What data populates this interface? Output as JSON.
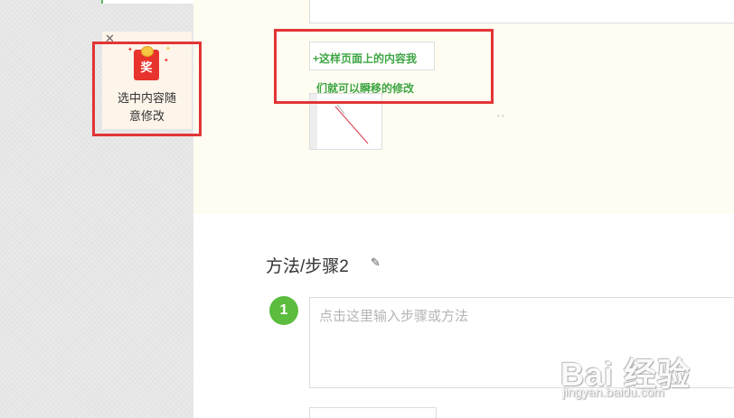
{
  "promo": {
    "close_glyph": "✕",
    "icon_char": "奖",
    "line1": "选中内容随",
    "line2": "意修改",
    "accent_color": "#e8332d"
  },
  "editor": {
    "add_link_label": "+这样页面上的内容我",
    "add_link_label_line2": "们就可以瞬移的修改",
    "accent_color": "#3fa644"
  },
  "section": {
    "title": "方法/步骤2",
    "step_number": "1",
    "step_placeholder": "点击这里输入步骤或方法"
  },
  "watermark": {
    "logo_text": "Bai 经验",
    "url_text": "jingyan.baidu.com"
  },
  "annotation": {
    "highlight_color": "#e23535"
  }
}
